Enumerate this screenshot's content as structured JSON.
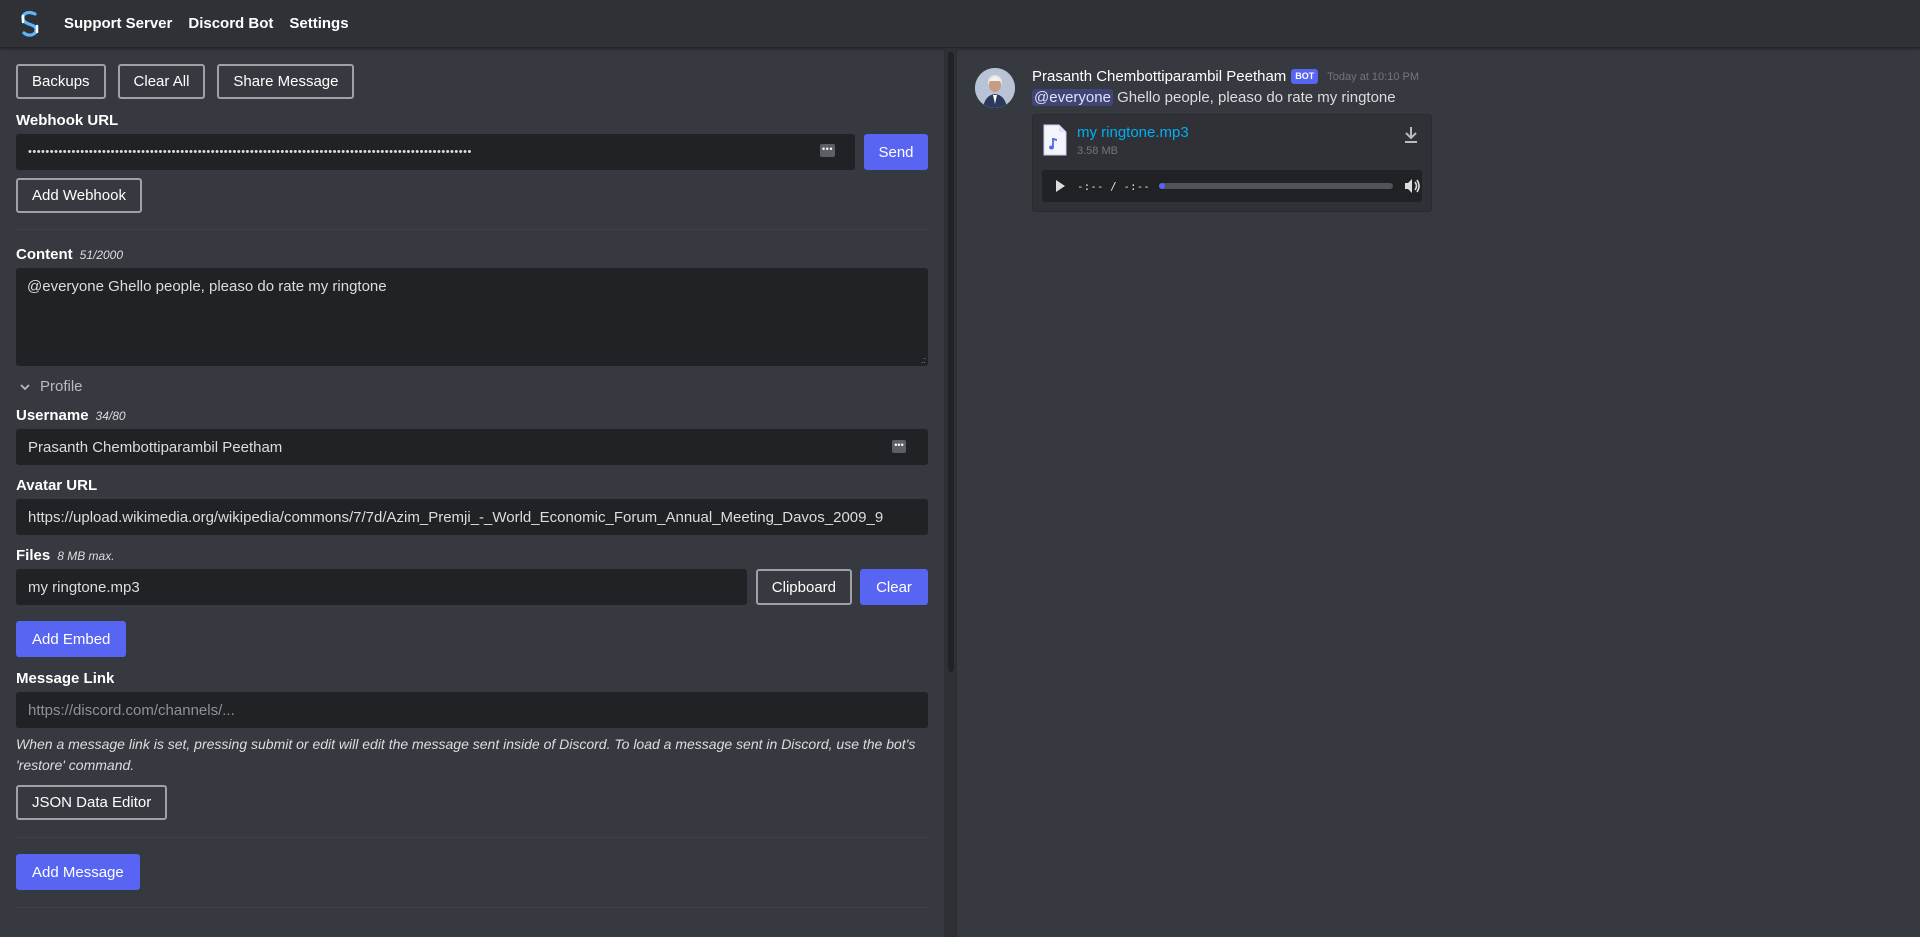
{
  "nav": {
    "links": [
      "Support Server",
      "Discord Bot",
      "Settings"
    ]
  },
  "toolbar": {
    "backups": "Backups",
    "clear_all": "Clear All",
    "share_message": "Share Message"
  },
  "webhook": {
    "label": "Webhook URL",
    "value_masked": "••••••••••••••••••••••••••••••••••••••••••••••••••••••••••••••••••••••••••••••••••••••••••••••••••••••",
    "send": "Send",
    "add_webhook": "Add Webhook"
  },
  "content": {
    "label": "Content",
    "counter": "51/2000",
    "value": "@everyone Ghello people, pleaso do rate my ringtone"
  },
  "profile": {
    "toggle_label": "Profile",
    "username_label": "Username",
    "username_counter": "34/80",
    "username_value": "Prasanth Chembottiparambil Peetham",
    "avatar_label": "Avatar URL",
    "avatar_value": "https://upload.wikimedia.org/wikipedia/commons/7/7d/Azim_Premji_-_World_Economic_Forum_Annual_Meeting_Davos_2009_9"
  },
  "files": {
    "label": "Files",
    "limit": "8 MB max.",
    "value": "my ringtone.mp3",
    "clipboard": "Clipboard",
    "clear": "Clear"
  },
  "add_embed": "Add Embed",
  "message_link": {
    "label": "Message Link",
    "placeholder": "https://discord.com/channels/...",
    "help": "When a message link is set, pressing submit or edit will edit the message sent inside of Discord. To load a message sent in Discord, use the bot's 'restore' command."
  },
  "json_editor": "JSON Data Editor",
  "add_message": "Add Message",
  "preview": {
    "username": "Prasanth Chembottiparambil Peetham",
    "bot_tag": "BOT",
    "timestamp": "Today at 10:10 PM",
    "mention": "@everyone",
    "text": " Ghello people, pleaso do rate my ringtone",
    "attachment_name": "my ringtone.mp3",
    "attachment_size": "3.58 MB",
    "audio_time": "-:-- / -:--"
  },
  "colors": {
    "accent": "#5865f2",
    "link": "#00aff4",
    "background": "#36393f",
    "input": "#202225"
  }
}
